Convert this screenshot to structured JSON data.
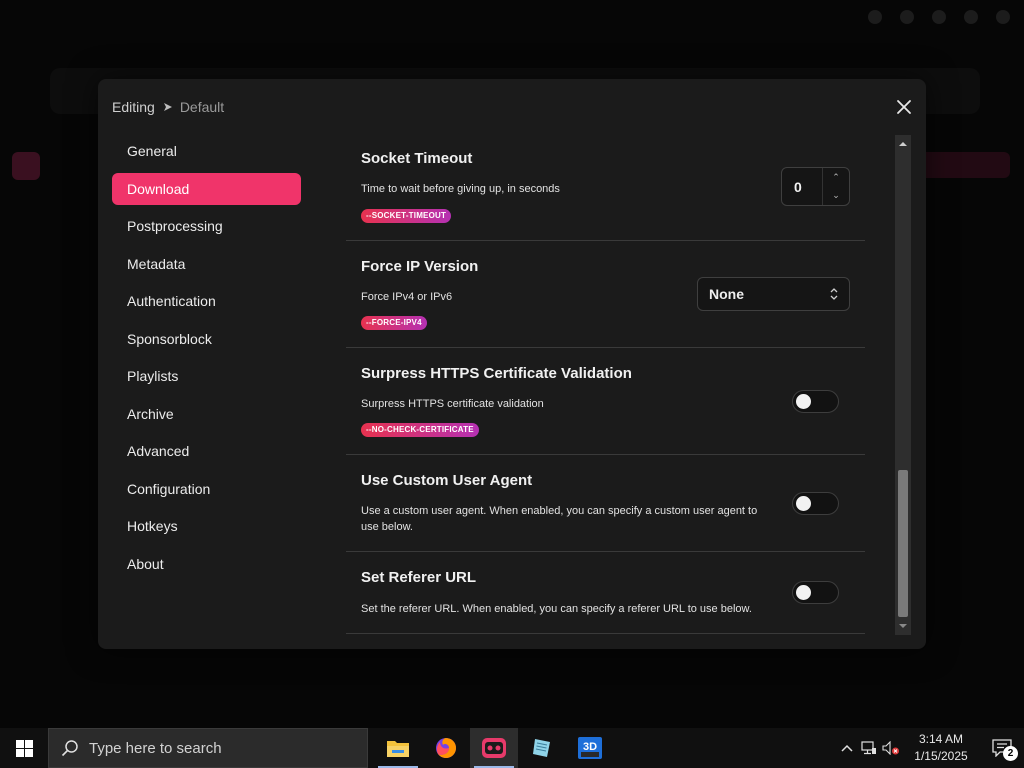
{
  "breadcrumb": {
    "prefix": "Editing",
    "current": "Default"
  },
  "nav": {
    "items": [
      {
        "label": "General"
      },
      {
        "label": "Download"
      },
      {
        "label": "Postprocessing"
      },
      {
        "label": "Metadata"
      },
      {
        "label": "Authentication"
      },
      {
        "label": "Sponsorblock"
      },
      {
        "label": "Playlists"
      },
      {
        "label": "Archive"
      },
      {
        "label": "Advanced"
      },
      {
        "label": "Configuration"
      },
      {
        "label": "Hotkeys"
      },
      {
        "label": "About"
      }
    ],
    "active": "Download"
  },
  "settings": {
    "socket_timeout": {
      "title": "Socket Timeout",
      "description": "Time to wait before giving up, in seconds",
      "flag": "--SOCKET-TIMEOUT",
      "value": "0"
    },
    "force_ip": {
      "title": "Force IP Version",
      "description": "Force IPv4 or IPv6",
      "flag": "--FORCE-IPV4",
      "selected": "None"
    },
    "suppress_https": {
      "title": "Surpress HTTPS Certificate Validation",
      "description": "Surpress HTTPS certificate validation",
      "flag": "--NO-CHECK-CERTIFICATE",
      "enabled": false
    },
    "custom_user_agent": {
      "title": "Use Custom User Agent",
      "description": "Use a custom user agent. When enabled, you can specify a custom user agent to use below.",
      "enabled": false
    },
    "referer_url": {
      "title": "Set Referer URL",
      "description": "Set the referer URL. When enabled, you can specify a referer URL to use below.",
      "enabled": false
    }
  },
  "colors": {
    "accent": "#f0346a",
    "tag_start": "#e7324f",
    "tag_end": "#b531b3",
    "modal_bg": "#1b1b1b"
  },
  "icons": {
    "breadcrumb_separator": "chevron-right-icon",
    "close": "close-icon"
  },
  "taskbar": {
    "search_placeholder": "Type here to search",
    "apps": [
      "file-explorer-icon",
      "firefox-icon",
      "ytdlp-gui-icon",
      "notepad-icon",
      "3d-viewer-icon"
    ],
    "time": "3:14 AM",
    "date": "1/15/2025",
    "notification_count": "2"
  }
}
